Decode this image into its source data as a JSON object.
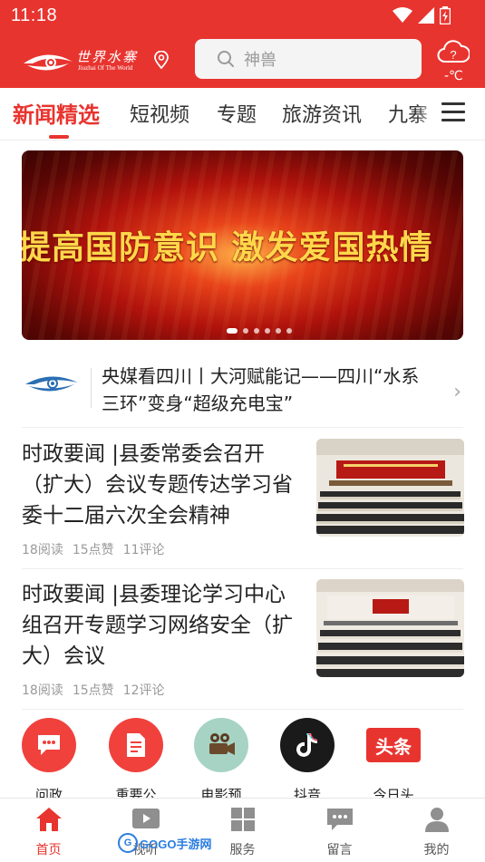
{
  "status": {
    "time": "11:18"
  },
  "header": {
    "logo_title": "世界水寨",
    "logo_subtitle": "Jiuzhai Of The World",
    "search_placeholder": "神兽",
    "weather_temp": "-℃"
  },
  "tabs": [
    {
      "label": "新闻精选",
      "active": true
    },
    {
      "label": "短视频"
    },
    {
      "label": "专题"
    },
    {
      "label": "旅游资讯"
    },
    {
      "label": "九寨"
    }
  ],
  "banner": {
    "text": "提高国防意识 激发爱国热情",
    "pages": 6,
    "current_page": 1
  },
  "headline": {
    "text": "央媒看四川丨大河赋能记——四川“水系三环”变身“超级充电宝”"
  },
  "articles": [
    {
      "title": "时政要闻 |县委常委会召开（扩大）会议专题传达学习省委十二届六次全会精神",
      "reads": "18阅读",
      "likes": "15点赞",
      "comments": "11评论"
    },
    {
      "title": "时政要闻 |县委理论学习中心组召开专题学习网络安全（扩大）会议",
      "reads": "18阅读",
      "likes": "15点赞",
      "comments": "12评论"
    }
  ],
  "quick_links": [
    {
      "label": "问政",
      "icon": "chat-bubble-icon",
      "color": "#f0413d"
    },
    {
      "label": "重要公",
      "icon": "document-icon",
      "color": "#f0413d"
    },
    {
      "label": "电影预",
      "icon": "film-camera-icon",
      "color": "#a6d3c4"
    },
    {
      "label": "抖音",
      "icon": "tiktok-icon",
      "color": "#1a1a1a"
    },
    {
      "label": "今日头",
      "icon": "toutiao-icon",
      "color": "#e8342f",
      "badge": "头条"
    }
  ],
  "bottom_nav": [
    {
      "label": "首页",
      "icon": "home-icon",
      "active": true
    },
    {
      "label": "视听",
      "icon": "video-icon"
    },
    {
      "label": "服务",
      "icon": "grid-icon"
    },
    {
      "label": "留言",
      "icon": "message-icon"
    },
    {
      "label": "我的",
      "icon": "user-icon"
    }
  ],
  "watermark": {
    "text": "GOGO手游网"
  },
  "colors": {
    "brand_red": "#e8342f",
    "gray_text": "#999999"
  }
}
